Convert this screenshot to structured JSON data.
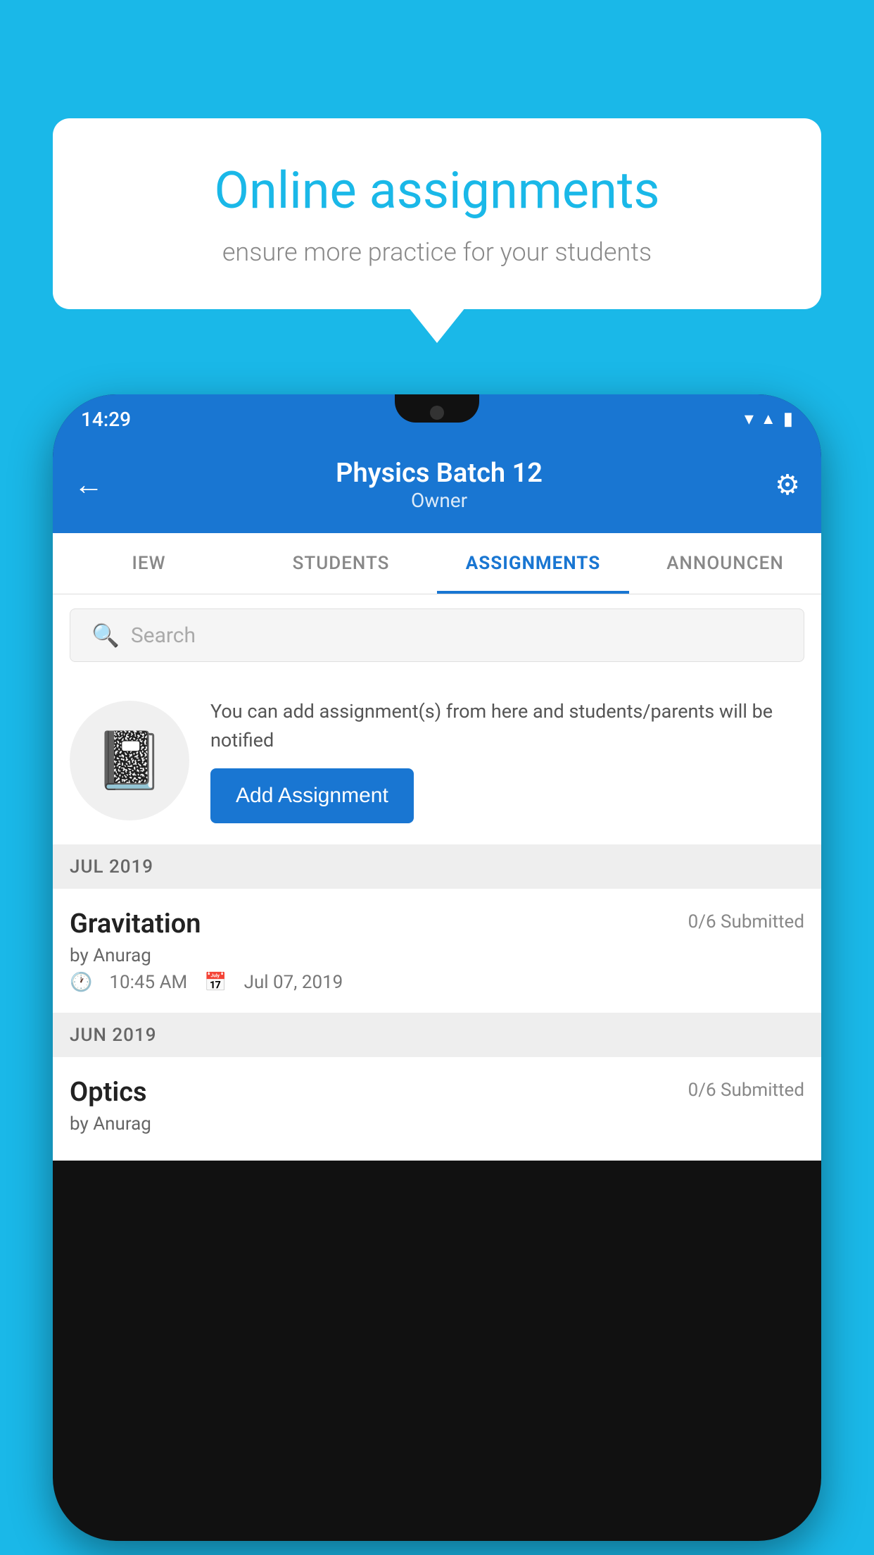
{
  "background_color": "#1AB8E8",
  "speech_bubble": {
    "title": "Online assignments",
    "subtitle": "ensure more practice for your students"
  },
  "status_bar": {
    "time": "14:29",
    "icons": [
      "wifi",
      "signal",
      "battery"
    ]
  },
  "header": {
    "title": "Physics Batch 12",
    "subtitle": "Owner",
    "back_label": "←",
    "settings_label": "⚙"
  },
  "tabs": [
    {
      "label": "IEW",
      "active": false
    },
    {
      "label": "STUDENTS",
      "active": false
    },
    {
      "label": "ASSIGNMENTS",
      "active": true
    },
    {
      "label": "ANNOUNCEN",
      "active": false
    }
  ],
  "search": {
    "placeholder": "Search"
  },
  "promo": {
    "text": "You can add assignment(s) from here and students/parents will be notified",
    "add_button": "Add Assignment"
  },
  "sections": [
    {
      "label": "JUL 2019",
      "assignments": [
        {
          "name": "Gravitation",
          "submitted": "0/6 Submitted",
          "by": "by Anurag",
          "time": "10:45 AM",
          "date": "Jul 07, 2019"
        }
      ]
    },
    {
      "label": "JUN 2019",
      "assignments": [
        {
          "name": "Optics",
          "submitted": "0/6 Submitted",
          "by": "by Anurag",
          "time": "",
          "date": ""
        }
      ]
    }
  ]
}
